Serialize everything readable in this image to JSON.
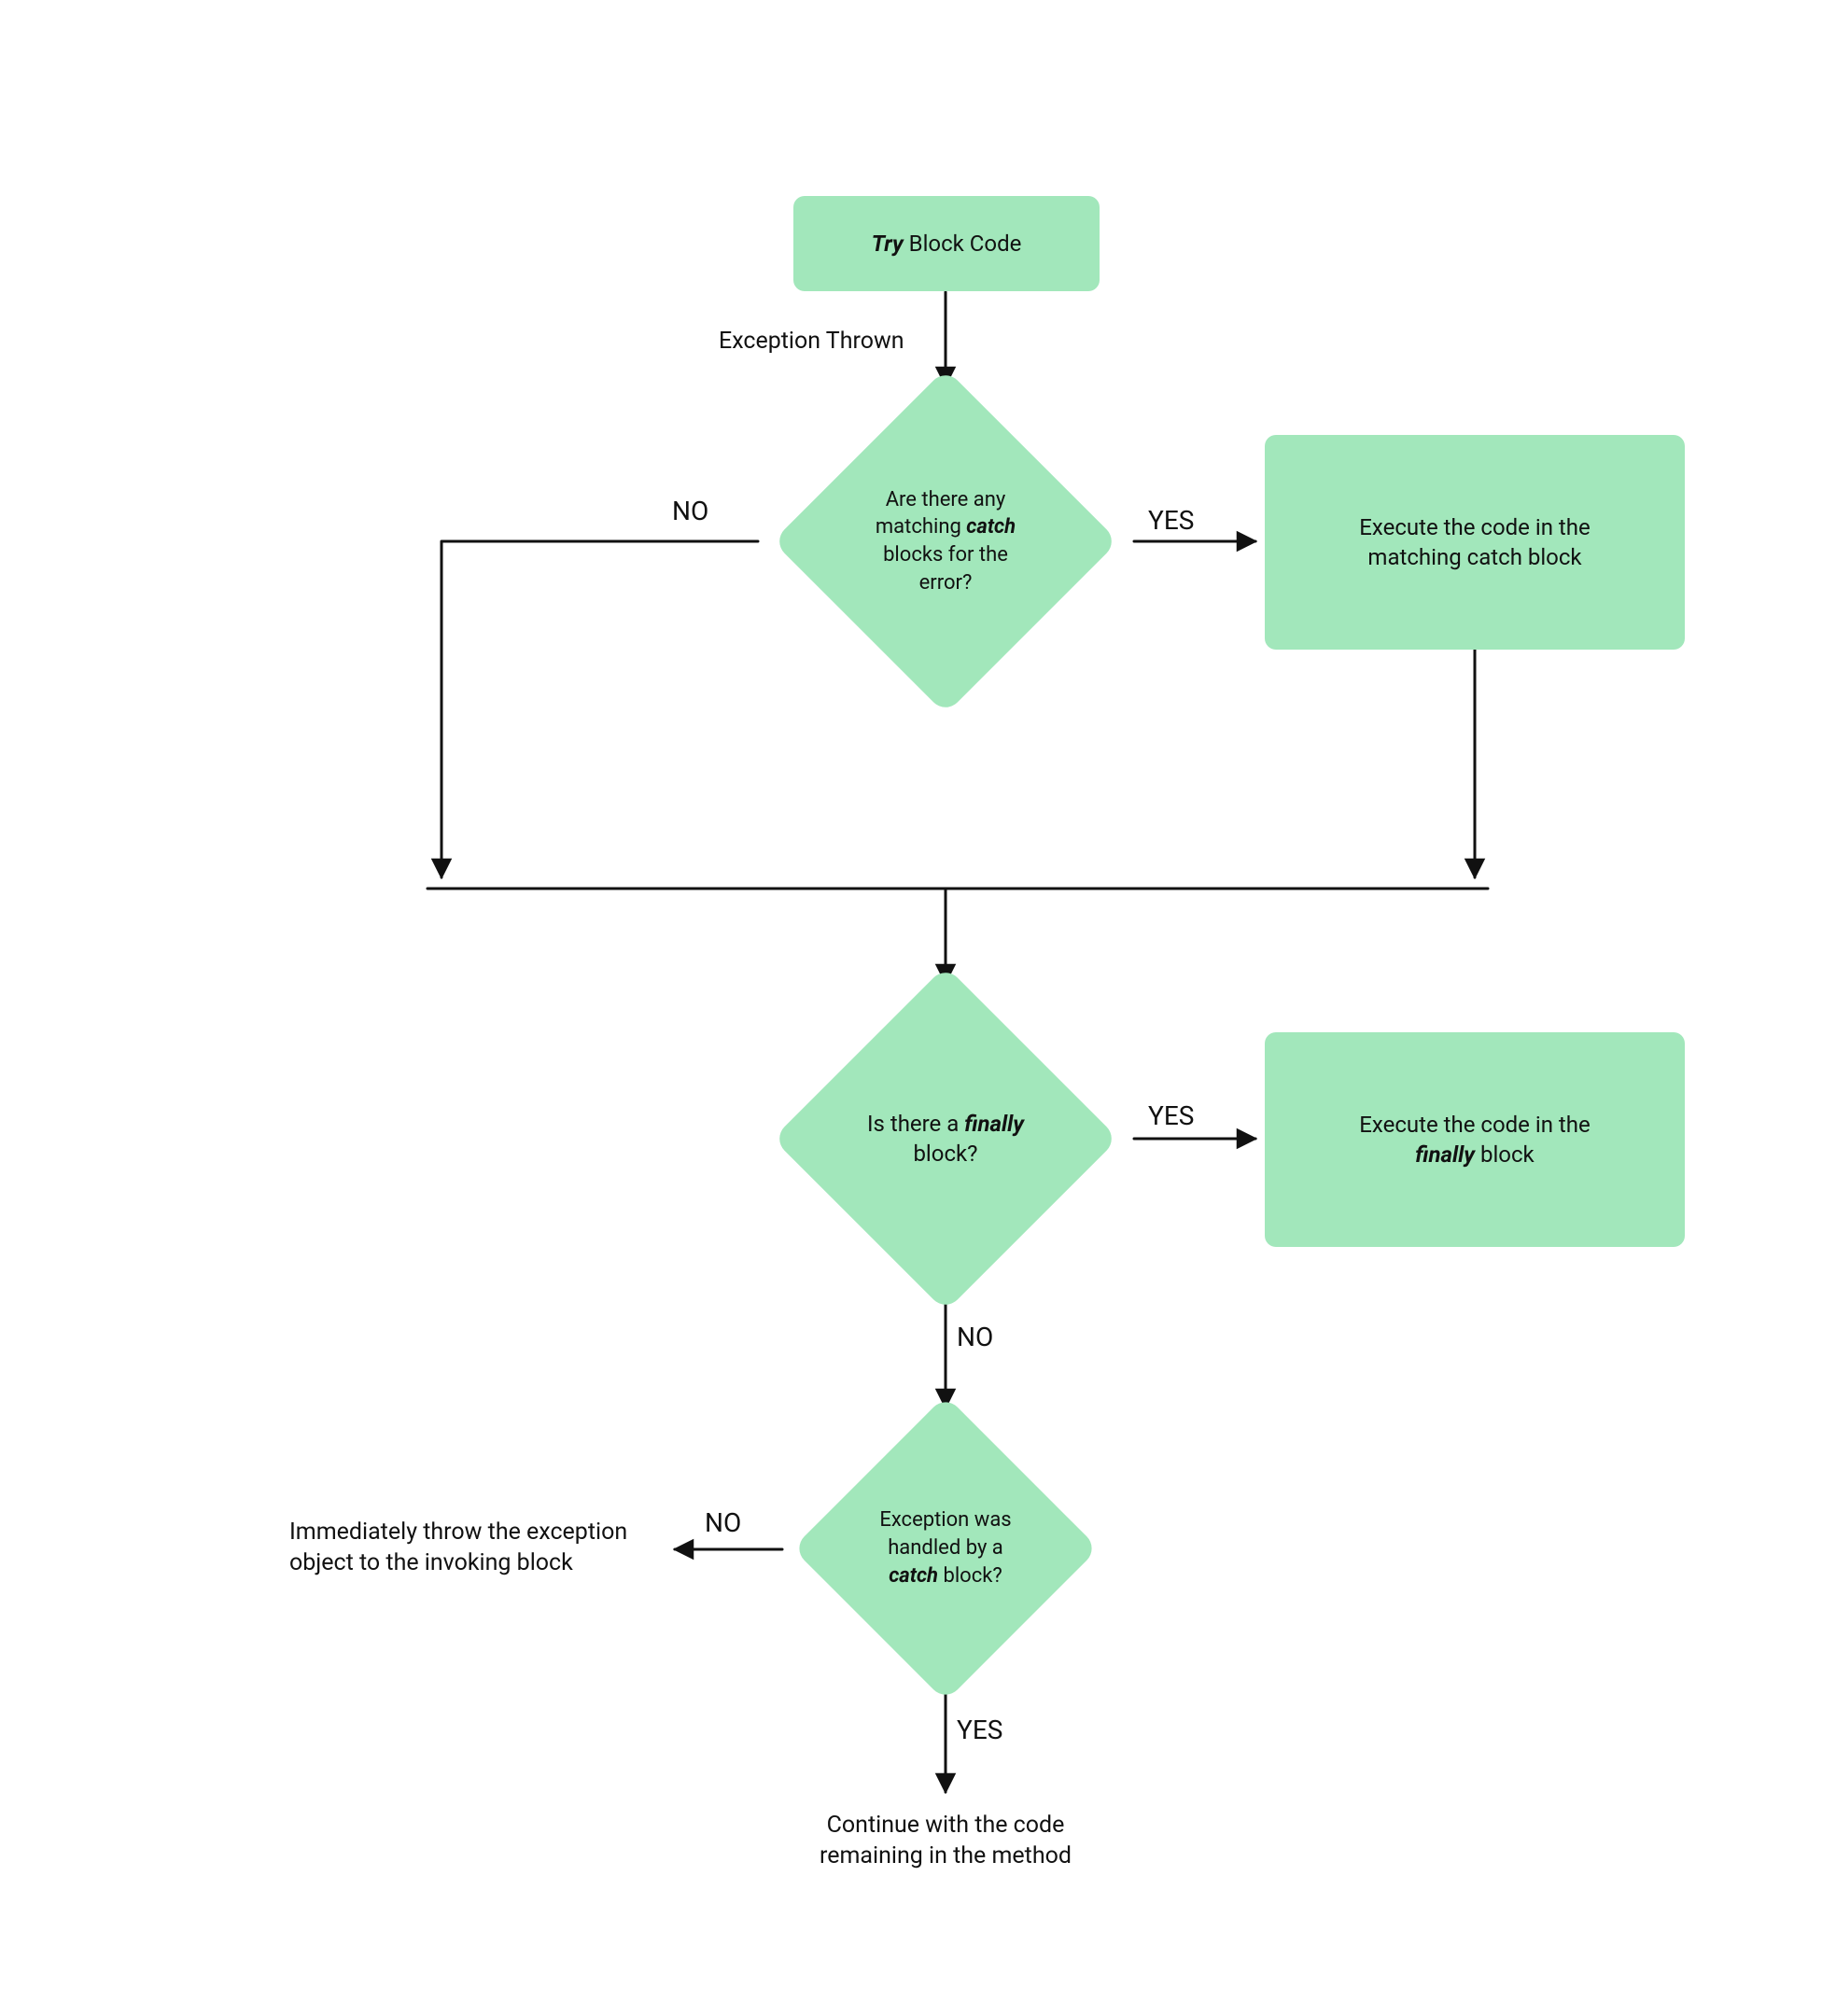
{
  "diagram_type": "flowchart",
  "colors": {
    "node_fill": "#a2e7bb",
    "stroke": "#111111",
    "background": "#ffffff"
  },
  "nodes": {
    "start": {
      "kind": "process",
      "try_word": "Try",
      "rest": " Block Code"
    },
    "d1": {
      "kind": "decision",
      "l1": "Are there any",
      "l2a": "matching ",
      "l2b": "catch",
      "l3": "blocks for the",
      "l4": "error?"
    },
    "p1": {
      "kind": "process",
      "l1": "Execute the code in the",
      "l2": "matching catch block"
    },
    "d2": {
      "kind": "decision",
      "l1a": "Is there a ",
      "l1b": "finally",
      "l2": "block?"
    },
    "p2": {
      "kind": "process",
      "l1": "Execute the code in the",
      "l2a": "finally",
      "l2b": " block"
    },
    "d3": {
      "kind": "decision",
      "l1": "Exception was",
      "l2": "handled by a",
      "l3a": "catch",
      "l3b": " block?"
    },
    "out_continue": {
      "l1": "Continue with the code",
      "l2": "remaining in the method"
    },
    "out_throw": {
      "l1": "Immediately throw the exception",
      "l2": "object to the invoking block"
    }
  },
  "edges": {
    "start_d1": "Exception Thrown",
    "d1_no": "NO",
    "d1_yes": "YES",
    "d2_yes": "YES",
    "d2_no": "NO",
    "d3_yes": "YES",
    "d3_no": "NO"
  }
}
